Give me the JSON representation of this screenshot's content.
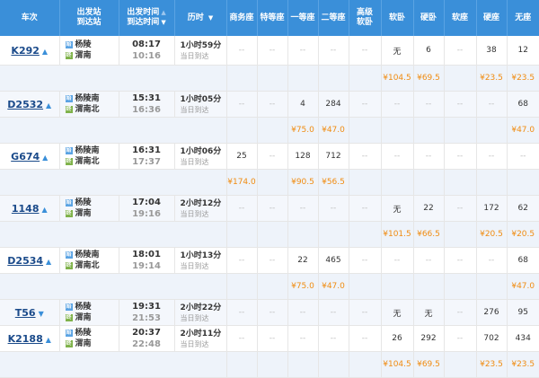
{
  "header": {
    "train": "车次",
    "station_from": "出发站",
    "station_to": "到达站",
    "time_dep": "出发时间",
    "time_arr": "到达时间",
    "duration": "历时",
    "sort_down": "▼",
    "sort_up": "▲",
    "seats": [
      "商务座",
      "特等座",
      "一等座",
      "二等座",
      "高级\n软卧",
      "软卧",
      "硬卧",
      "软座",
      "硬座",
      "无座"
    ]
  },
  "expand_arrows": {
    "up": "▲",
    "down": "▼"
  },
  "station_badges": {
    "from": "始",
    "to": "终"
  },
  "trains": [
    {
      "no": "K292",
      "arrow": "up",
      "from": "杨陵",
      "to": "渭南",
      "dep": "08:17",
      "arr": "10:16",
      "dur": "1小时59分",
      "day": "当日到达",
      "seats": [
        "--",
        "--",
        "--",
        "--",
        "--",
        "无",
        "6",
        "--",
        "38",
        "12"
      ],
      "prices": [
        "",
        "",
        "",
        "",
        "",
        "¥104.5",
        "¥69.5",
        "",
        "¥23.5",
        "¥23.5"
      ]
    },
    {
      "no": "D2532",
      "arrow": "up",
      "from": "杨陵南",
      "to": "渭南北",
      "dep": "15:31",
      "arr": "16:36",
      "dur": "1小时05分",
      "day": "当日到达",
      "seats": [
        "--",
        "--",
        "4",
        "284",
        "--",
        "--",
        "--",
        "--",
        "--",
        "68"
      ],
      "prices": [
        "",
        "",
        "¥75.0",
        "¥47.0",
        "",
        "",
        "",
        "",
        "",
        "¥47.0"
      ]
    },
    {
      "no": "G674",
      "arrow": "up",
      "from": "杨陵南",
      "to": "渭南北",
      "dep": "16:31",
      "arr": "17:37",
      "dur": "1小时06分",
      "day": "当日到达",
      "seats": [
        "25",
        "--",
        "128",
        "712",
        "--",
        "--",
        "--",
        "--",
        "--",
        "--"
      ],
      "prices": [
        "¥174.0",
        "",
        "¥90.5",
        "¥56.5",
        "",
        "",
        "",
        "",
        "",
        ""
      ]
    },
    {
      "no": "1148",
      "arrow": "up",
      "from": "杨陵",
      "to": "渭南",
      "dep": "17:04",
      "arr": "19:16",
      "dur": "2小时12分",
      "day": "当日到达",
      "seats": [
        "--",
        "--",
        "--",
        "--",
        "--",
        "无",
        "22",
        "--",
        "172",
        "62"
      ],
      "prices": [
        "",
        "",
        "",
        "",
        "",
        "¥101.5",
        "¥66.5",
        "",
        "¥20.5",
        "¥20.5"
      ]
    },
    {
      "no": "D2534",
      "arrow": "up",
      "from": "杨陵南",
      "to": "渭南北",
      "dep": "18:01",
      "arr": "19:14",
      "dur": "1小时13分",
      "day": "当日到达",
      "seats": [
        "--",
        "--",
        "22",
        "465",
        "--",
        "--",
        "--",
        "--",
        "--",
        "68"
      ],
      "prices": [
        "",
        "",
        "¥75.0",
        "¥47.0",
        "",
        "",
        "",
        "",
        "",
        "¥47.0"
      ]
    },
    {
      "no": "T56",
      "arrow": "down",
      "from": "杨陵",
      "to": "渭南",
      "dep": "19:31",
      "arr": "21:53",
      "dur": "2小时22分",
      "day": "当日到达",
      "seats": [
        "--",
        "--",
        "--",
        "--",
        "--",
        "无",
        "无",
        "--",
        "276",
        "95"
      ],
      "prices": null
    },
    {
      "no": "K2188",
      "arrow": "up",
      "from": "杨陵",
      "to": "渭南",
      "dep": "20:37",
      "arr": "22:48",
      "dur": "2小时11分",
      "day": "当日到达",
      "seats": [
        "--",
        "--",
        "--",
        "--",
        "--",
        "26",
        "292",
        "--",
        "702",
        "434"
      ],
      "prices": [
        "",
        "",
        "",
        "",
        "",
        "¥104.5",
        "¥69.5",
        "",
        "¥23.5",
        "¥23.5"
      ]
    }
  ]
}
